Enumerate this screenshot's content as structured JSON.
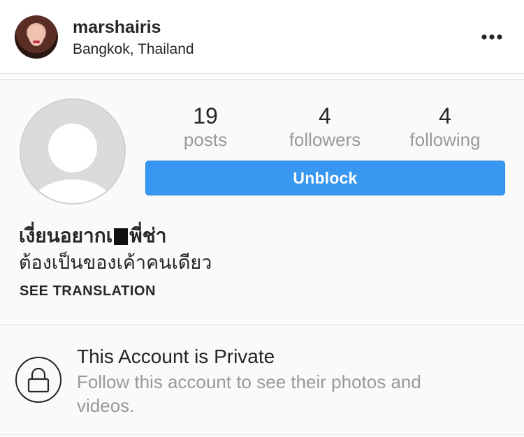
{
  "header": {
    "username": "marshairis",
    "location": "Bangkok, Thailand",
    "more_icon": "more-horizontal-icon"
  },
  "profile": {
    "stats": [
      {
        "value": "19",
        "label": "posts"
      },
      {
        "value": "4",
        "label": "followers"
      },
      {
        "value": "4",
        "label": "following"
      }
    ],
    "unblock_label": "Unblock",
    "bio_line1_part1": "เงี่ยนอยากเ",
    "bio_line1_part2": "พี่ช่า",
    "bio_line2": "ต้องเป็นของเค้าคนเดียว",
    "see_translation": "SEE TRANSLATION"
  },
  "private": {
    "title": "This Account is Private",
    "text": "Follow this account to see their photos and videos."
  },
  "colors": {
    "accent": "#3897f0",
    "text": "#262626",
    "muted": "#999999"
  }
}
